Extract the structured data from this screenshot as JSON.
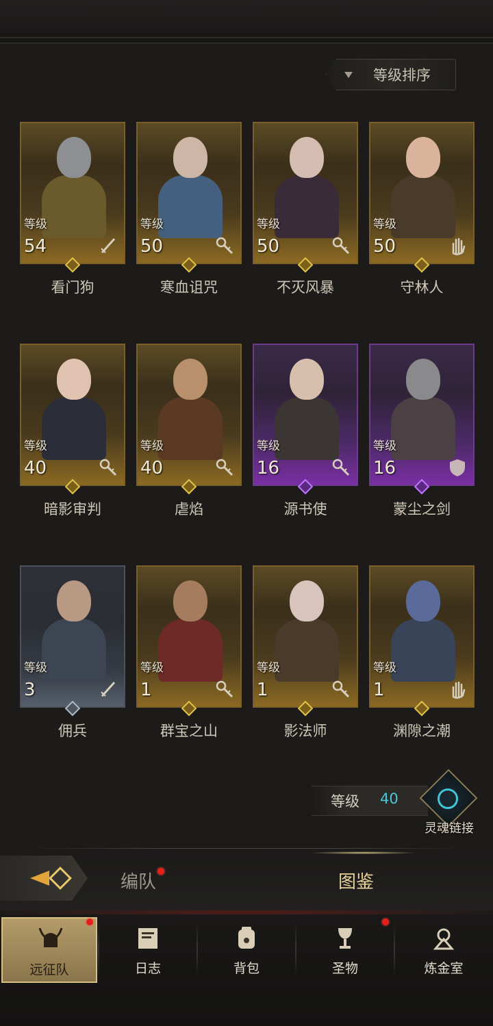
{
  "sort": {
    "label": "等级排序",
    "icon": "triangle-down-icon"
  },
  "heroes": [
    {
      "name": "看门狗",
      "level_label": "等级",
      "level": "54",
      "rarity": "gold",
      "class_icon": "sword-icon",
      "skin": "#8e8f93",
      "cloth": "#6b5a2c"
    },
    {
      "name": "寒血诅咒",
      "level_label": "等级",
      "level": "50",
      "rarity": "gold",
      "class_icon": "key-wand-icon",
      "skin": "#cdb6a5",
      "cloth": "#44607e"
    },
    {
      "name": "不灭风暴",
      "level_label": "等级",
      "level": "50",
      "rarity": "gold",
      "class_icon": "key-wand-icon",
      "skin": "#d4bcb0",
      "cloth": "#3a2b38"
    },
    {
      "name": "守林人",
      "level_label": "等级",
      "level": "50",
      "rarity": "gold",
      "class_icon": "hand-icon",
      "skin": "#d9b39c",
      "cloth": "#4a3a2a"
    },
    {
      "name": "暗影审判",
      "level_label": "等级",
      "level": "40",
      "rarity": "gold",
      "class_icon": "key-wand-icon",
      "skin": "#e0c2b0",
      "cloth": "#2b2d38"
    },
    {
      "name": "虐焰",
      "level_label": "等级",
      "level": "40",
      "rarity": "gold",
      "class_icon": "key-wand-icon",
      "skin": "#b8906c",
      "cloth": "#5a3a22"
    },
    {
      "name": "源书使",
      "level_label": "等级",
      "level": "16",
      "rarity": "purple",
      "class_icon": "key-wand-icon",
      "skin": "#d6c0ad",
      "cloth": "#3b3533"
    },
    {
      "name": "蒙尘之剑",
      "level_label": "等级",
      "level": "16",
      "rarity": "purple",
      "class_icon": "shield-icon",
      "skin": "#8a8a8c",
      "cloth": "#4b4145"
    },
    {
      "name": "佣兵",
      "level_label": "等级",
      "level": "3",
      "rarity": "gray",
      "class_icon": "sword-icon",
      "skin": "#b89a84",
      "cloth": "#3d4552"
    },
    {
      "name": "群宝之山",
      "level_label": "等级",
      "level": "1",
      "rarity": "gold",
      "class_icon": "key-wand-icon",
      "skin": "#a67c5e",
      "cloth": "#6e2a26"
    },
    {
      "name": "影法师",
      "level_label": "等级",
      "level": "1",
      "rarity": "gold",
      "class_icon": "key-wand-icon",
      "skin": "#d8c4bc",
      "cloth": "#4a3a2a"
    },
    {
      "name": "渊隙之潮",
      "level_label": "等级",
      "level": "1",
      "rarity": "gold",
      "class_icon": "hand-icon",
      "skin": "#5a6a9a",
      "cloth": "#3a4458"
    }
  ],
  "soul_link": {
    "level_label": "等级",
    "level": "40",
    "button_label": "灵魂链接",
    "accent": "#48c9d9"
  },
  "tabs": {
    "team": "编队",
    "atlas": "图鉴",
    "active": "atlas"
  },
  "nav": [
    {
      "label": "远征队",
      "icon": "horned-helmet-icon",
      "active": true,
      "badge": true
    },
    {
      "label": "日志",
      "icon": "scroll-icon",
      "active": false,
      "badge": false
    },
    {
      "label": "背包",
      "icon": "bag-icon",
      "active": false,
      "badge": false
    },
    {
      "label": "圣物",
      "icon": "chalice-icon",
      "active": false,
      "badge": true
    },
    {
      "label": "炼金室",
      "icon": "alchemy-icon",
      "active": false,
      "badge": false
    }
  ],
  "colors": {
    "gold_frame": "#7a5f2a",
    "purple_frame": "#6c3b8c",
    "badge_red": "#e5201b",
    "background": "#1c1b1a"
  }
}
